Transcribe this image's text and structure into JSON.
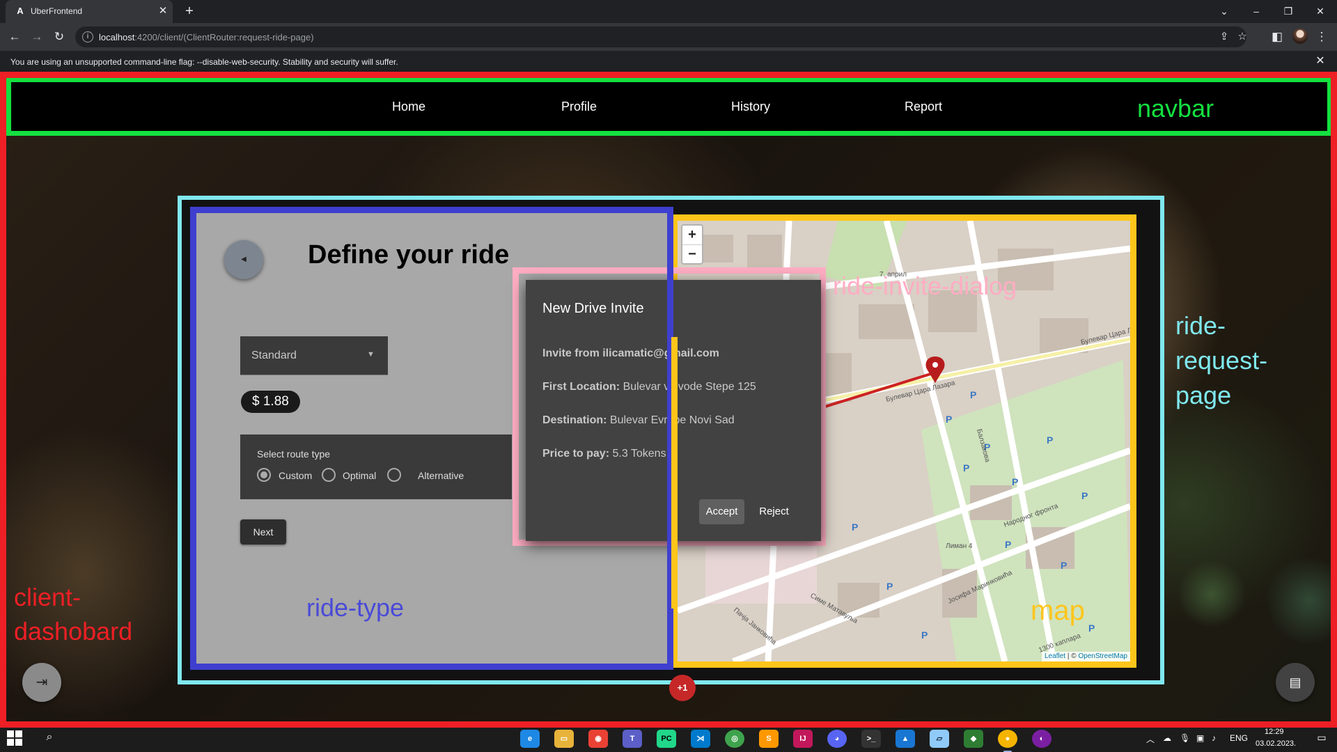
{
  "browser": {
    "tab_title": "UberFrontend",
    "tab_favicon": "A",
    "url_host": "localhost",
    "url_path": ":4200/client/(ClientRouter:request-ride-page)",
    "infobar_message": "You are using an unsupported command-line flag: --disable-web-security. Stability and security will suffer."
  },
  "navbar": {
    "links": [
      "Home",
      "Profile",
      "History",
      "Report"
    ],
    "annotation": "navbar"
  },
  "ride_type": {
    "title": "Define your ride",
    "vehicle_type": "Standard",
    "price": "$ 1.88",
    "route_label": "Select route type",
    "route_options": [
      "Custom",
      "Optimal",
      "Alternative"
    ],
    "selected_route": "Custom",
    "next_label": "Next",
    "annotation": "ride-type"
  },
  "invite_dialog": {
    "title": "New Drive Invite",
    "invite_label": "Invite from",
    "invite_value": "Invite from ilicamatic@gmail.com",
    "first_location_label": "First Location:",
    "first_location_value": "Bulevar vojvode Stepe 125",
    "destination_label": "Destination:",
    "destination_value": "Bulevar Evrope Novi Sad",
    "price_label": "Price to pay:",
    "price_value": "5.3 Tokens",
    "accept_label": "Accept",
    "reject_label": "Reject",
    "annotation": "ride-invite-dialog"
  },
  "map": {
    "zoom_in": "+",
    "zoom_out": "−",
    "attribution_leaflet": "Leaflet",
    "attribution_sep": " | © ",
    "attribution_osm": "OpenStreetMap",
    "annotation": "map",
    "street_labels": [
      "Булевар Цара Лазара",
      "Булевар Цара Лазара",
      "Лиман 4",
      "Народног фронта",
      "Балзакова",
      "Јосифа Маринковића",
      "1300 каплара",
      "Симе Матавуља",
      "Пачја Јанковића",
      "7. април"
    ],
    "route_color": "#cc2222",
    "marker_color": "#b71c1c"
  },
  "annotations": {
    "page": "ride-\nrequest-\npage",
    "dashboard": "client-\ndashobard"
  },
  "fab_badge": "+1",
  "taskbar": {
    "apps": [
      "edge-icon",
      "explorer-icon",
      "chrome-canary-icon",
      "teams-icon",
      "pycharm-icon",
      "vscode-icon",
      "xbox-icon",
      "sublime-icon",
      "intellij-icon",
      "discord-icon",
      "terminal-icon",
      "photos-icon",
      "notepad-icon",
      "git-icon",
      "chrome-icon",
      "figma-icon"
    ],
    "language": "ENG",
    "time": "12:29",
    "date": "03.02.2023."
  },
  "colors": {
    "navbar_outline": "#14e040",
    "dashboard_outline": "#ee1f25",
    "page_outline": "#7fe8ee",
    "ride_type_outline": "#3f3fcf",
    "map_outline": "#ffc51a",
    "dialog_outline": "#ffadc3"
  }
}
